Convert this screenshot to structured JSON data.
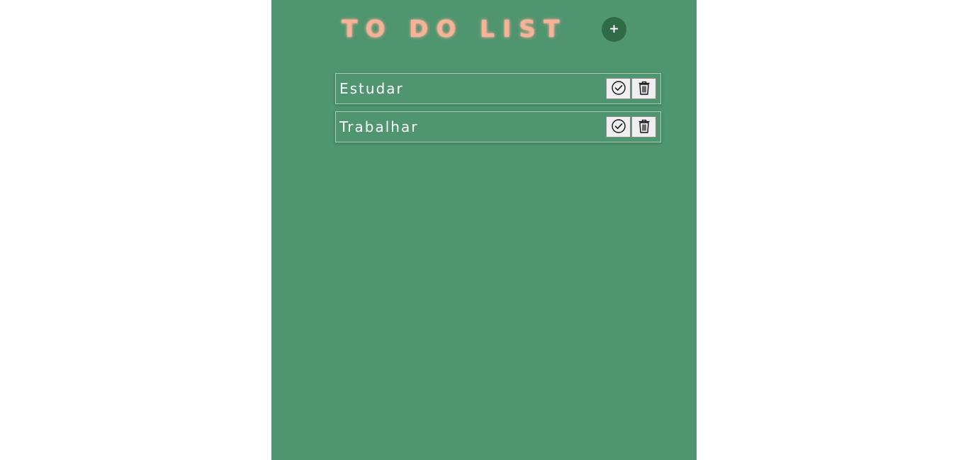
{
  "app": {
    "title": "TO DO LIST",
    "add_button_label": "+"
  },
  "tasks": [
    {
      "label": "Estudar",
      "complete_icon": "check-circle-icon",
      "delete_icon": "trash-icon"
    },
    {
      "label": "Trabalhar",
      "complete_icon": "check-circle-icon",
      "delete_icon": "trash-icon"
    }
  ],
  "colors": {
    "panel_background": "#4e9570",
    "title_color": "#f7b29a",
    "add_button_background": "#2e6b46",
    "task_text": "#ffffff",
    "action_button_background": "#efefef"
  }
}
